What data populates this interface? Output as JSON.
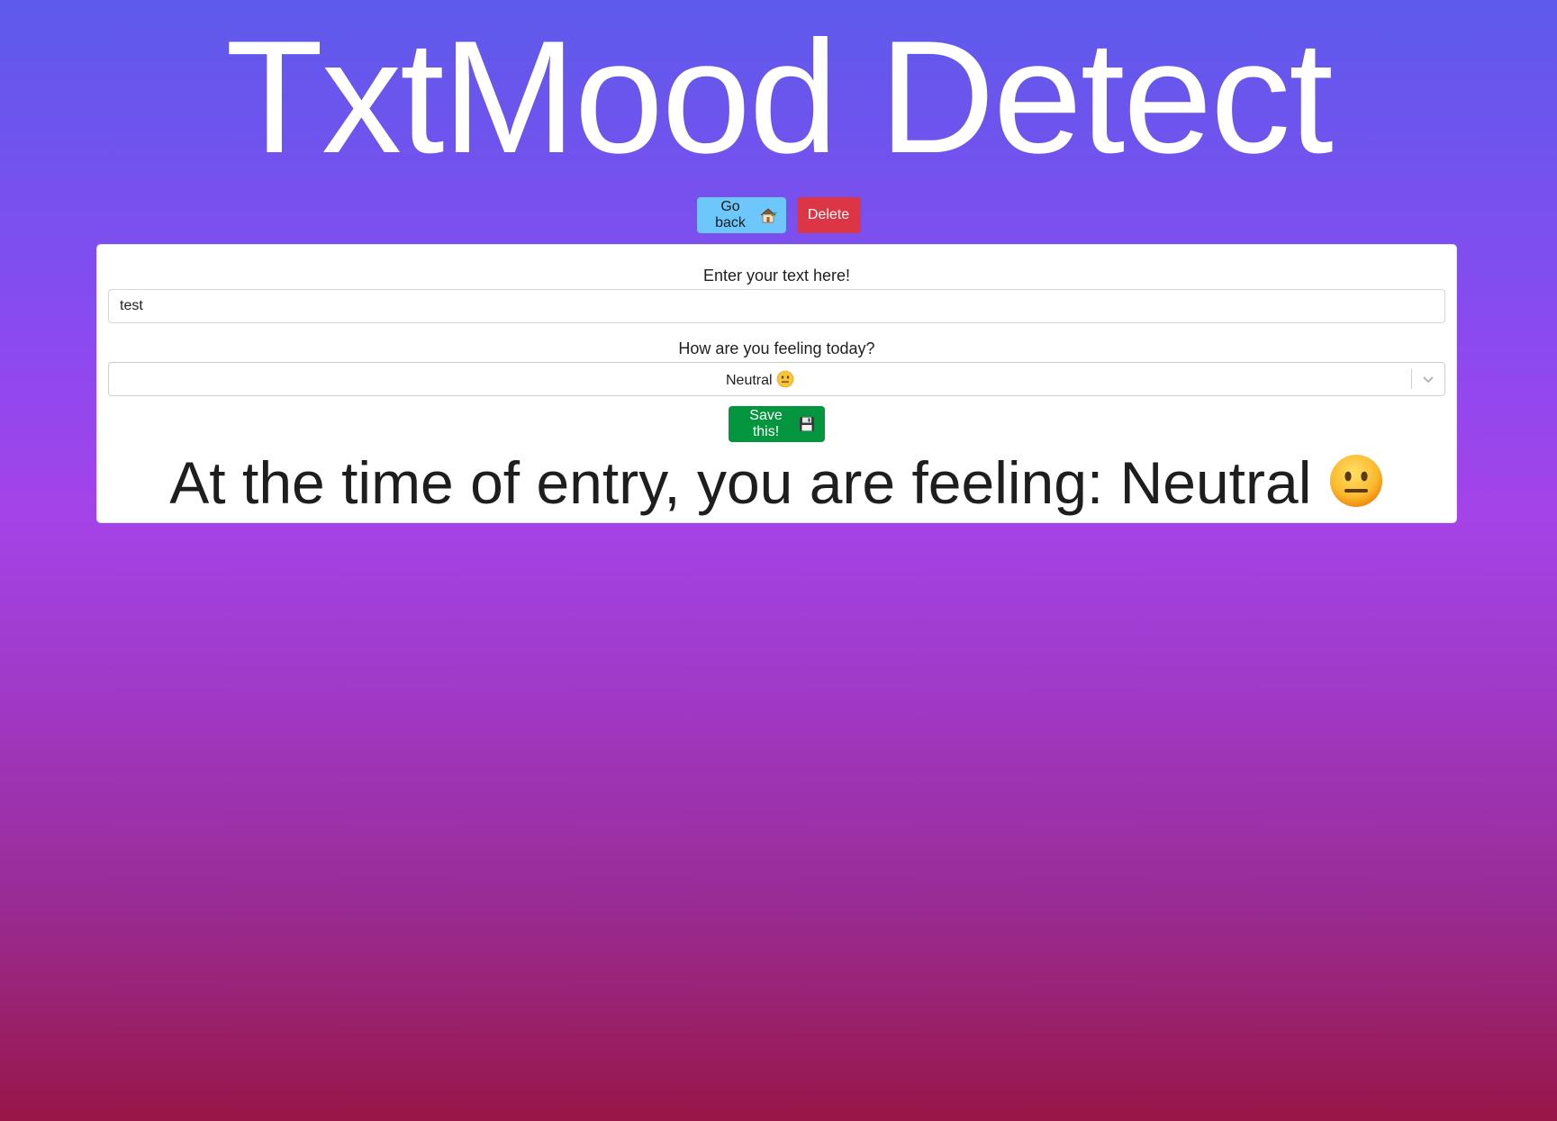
{
  "app": {
    "title": "TxtMood Detect"
  },
  "actions": {
    "back_label": "Go back",
    "back_icon": "house-icon",
    "delete_label": "Delete"
  },
  "form": {
    "text_label": "Enter your text here!",
    "text_value": "test",
    "mood_label": "How are you feeling today?",
    "mood_value": "Neutral",
    "mood_icon": "neutral-face-icon",
    "save_label": "Save this!",
    "save_icon": "floppy-disk-icon"
  },
  "result": {
    "text": "At the time of entry, you are feeling: Neutral",
    "icon": "neutral-face-icon"
  },
  "colors": {
    "back_button": "#6ec7fb",
    "delete_button": "#dc3545",
    "save_button": "#04963f",
    "gradient_top": "#5d5aec",
    "gradient_bottom": "#981648"
  }
}
